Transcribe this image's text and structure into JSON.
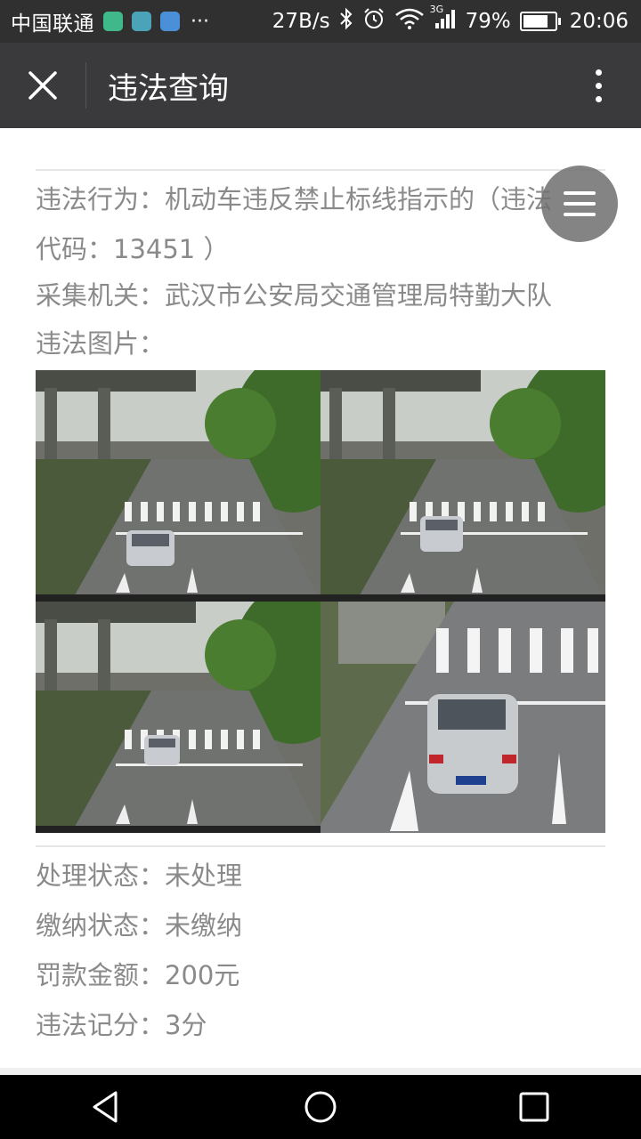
{
  "status_bar": {
    "carrier": "中国联通",
    "more": "···",
    "net_speed": "27B/s",
    "network_type": "3G",
    "battery": "79%",
    "battery_level": 0.79,
    "time": "20:06",
    "icons": [
      "wechat-app-icon",
      "gallery-app-icon",
      "wifi-app-icon",
      "bluetooth-icon",
      "alarm-icon",
      "wifi-icon",
      "signal-icon",
      "battery-icon"
    ]
  },
  "toolbar": {
    "title": "违法查询",
    "close_icon": "close-icon",
    "more_icon": "more-vertical-icon"
  },
  "violation": {
    "behavior_label": "违法行为：",
    "behavior_value_line1": "机动车违反禁止标线指示的（违法",
    "behavior_value_line2": "代码：13451 ）",
    "agency_label": "采集机关：",
    "agency_value": "武汉市公安局交通管理局特勤大队",
    "photos_label": "违法图片："
  },
  "status": {
    "process_label": "处理状态：",
    "process_value": "未处理",
    "payment_label": "缴纳状态：",
    "payment_value": "未缴纳",
    "fine_label": "罚款金额：",
    "fine_value": "200元",
    "points_label": "违法记分：",
    "points_value": "3分"
  },
  "colors": {
    "toolbar": "#3a3a3c",
    "statusbar": "#303030",
    "text_gray": "#8a8a8a",
    "float_menu": "#6e6e6e"
  },
  "nav_bar": {
    "icons": [
      "back-icon",
      "home-icon",
      "recents-icon"
    ]
  }
}
